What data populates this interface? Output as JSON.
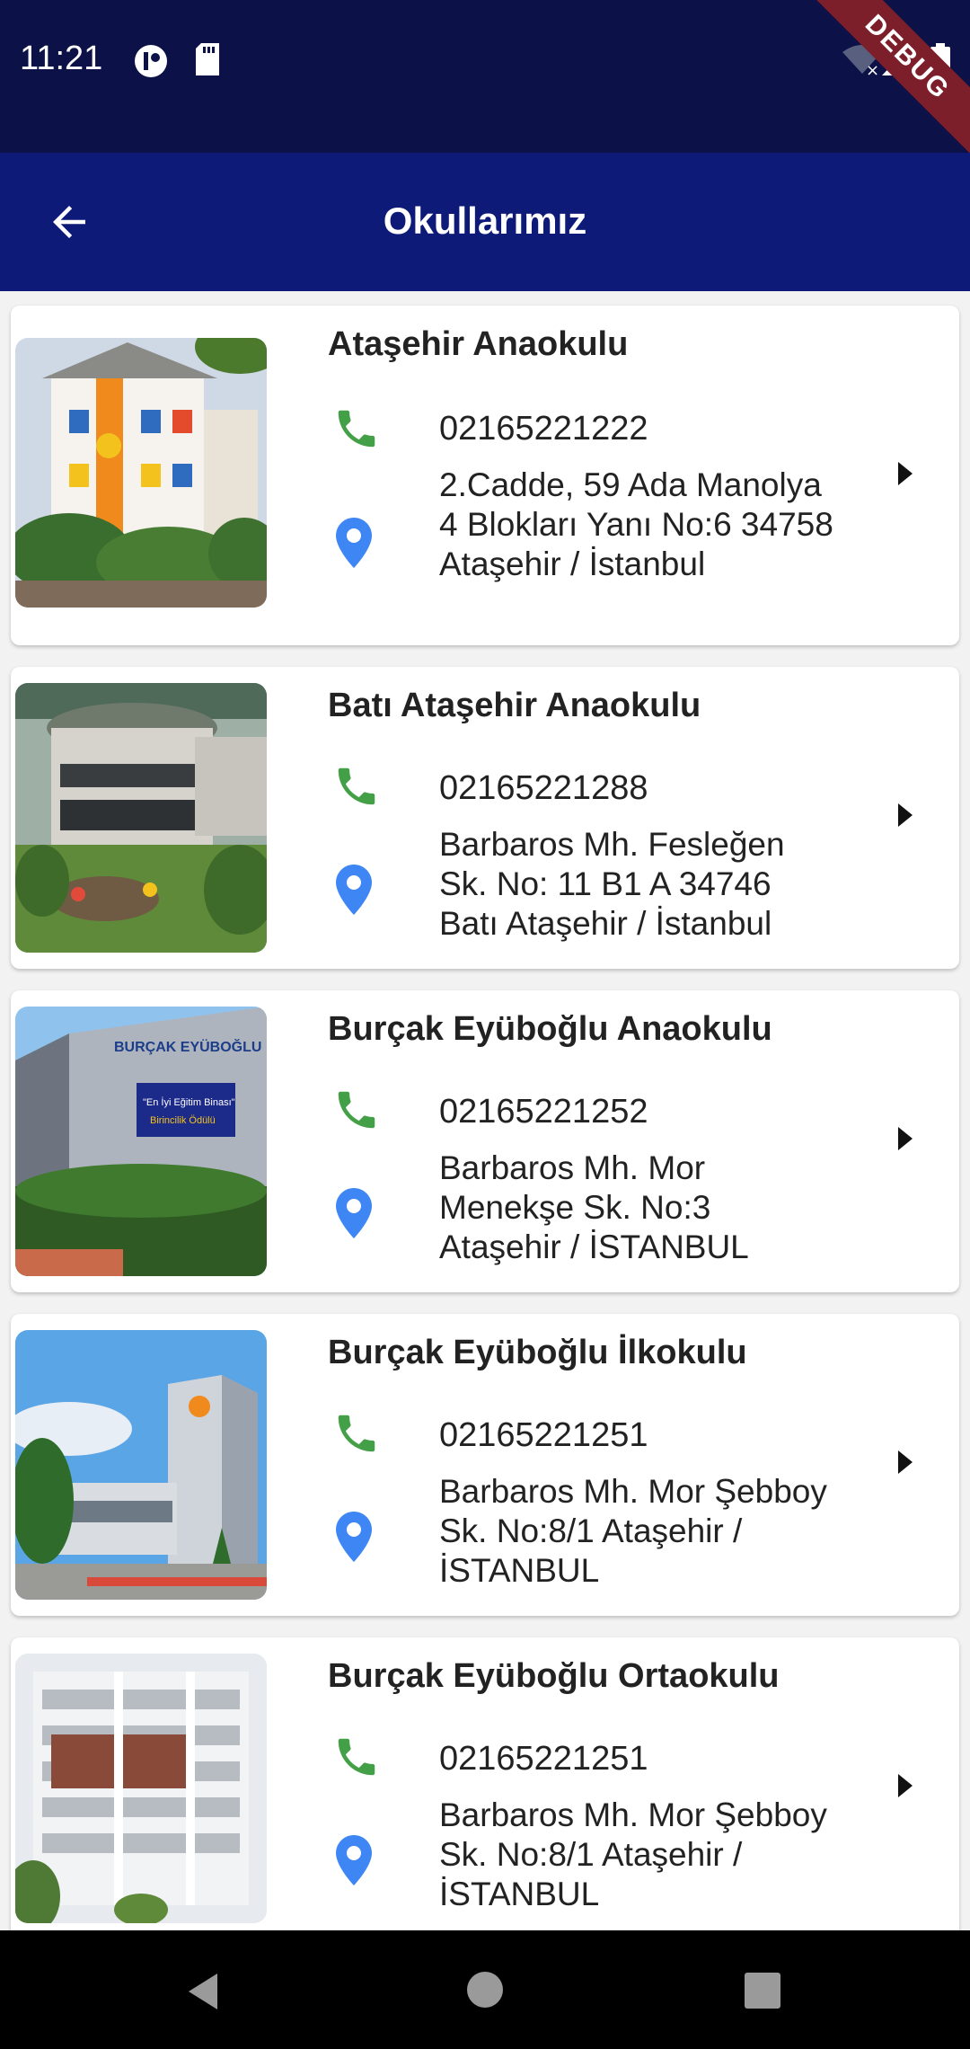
{
  "status_bar": {
    "time": "11:21",
    "debug_banner": "DEBUG"
  },
  "app_bar": {
    "title": "Okullarımız"
  },
  "schools": [
    {
      "name": "Ataşehir Anaokulu",
      "phone": "02165221222",
      "address": "2.Cadde, 59 Ada Manolya 4 Blokları Yanı No:6 34758 Ataşehir / İstanbul"
    },
    {
      "name": "Batı Ataşehir Anaokulu",
      "phone": "02165221288",
      "address": "Barbaros Mh. Fesleğen Sk. No: 11 B1 A 34746 Batı Ataşehir / İstanbul"
    },
    {
      "name": "Burçak Eyüboğlu Anaokulu",
      "phone": "02165221252",
      "address": "Barbaros Mh. Mor Menekşe Sk. No:3 Ataşehir / İSTANBUL"
    },
    {
      "name": "Burçak Eyüboğlu İlkokulu",
      "phone": "02165221251",
      "address": "Barbaros Mh. Mor Şebboy Sk. No:8/1 Ataşehir / İSTANBUL"
    },
    {
      "name": "Burçak Eyüboğlu Ortaokulu",
      "phone": "02165221251",
      "address": "Barbaros Mh. Mor Şebboy Sk. No:8/1 Ataşehir / İSTANBUL"
    }
  ],
  "colors": {
    "status_bar": "#0c1248",
    "app_bar": "#0d1a78",
    "phone_icon": "#43a047",
    "pin_icon": "#3f86f5"
  },
  "icons": {
    "back": "arrow-left-icon",
    "phone": "phone-icon",
    "location": "location-pin-icon",
    "chevron": "arrow-right-icon"
  }
}
